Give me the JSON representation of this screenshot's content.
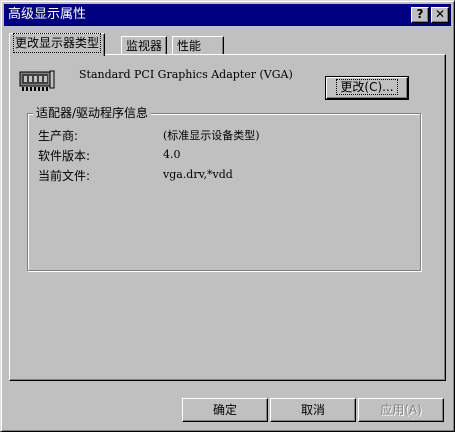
{
  "window": {
    "title": "高级显示属性",
    "help_glyph": "?",
    "close_glyph": "✕"
  },
  "tabs": [
    {
      "label": "更改显示器类型",
      "active": true
    },
    {
      "label": "监视器",
      "active": false
    },
    {
      "label": "性能",
      "active": false
    }
  ],
  "adapter": {
    "icon": "display-adapter-card-icon",
    "name": "Standard PCI Graphics Adapter (VGA)",
    "change_button": "更改(C)..."
  },
  "driver_info": {
    "legend": "适配器/驱动程序信息",
    "rows": [
      {
        "label": "生产商:",
        "value": "(标准显示设备类型)"
      },
      {
        "label": "软件版本:",
        "value": "4.0"
      },
      {
        "label": "当前文件:",
        "value": "vga.drv,*vdd"
      }
    ]
  },
  "buttons": {
    "ok": "确定",
    "cancel": "取消",
    "apply": "应用(A)"
  },
  "colors": {
    "face": "#c0c0c0",
    "titlebar": "#000080",
    "disabled_text": "#808080"
  }
}
